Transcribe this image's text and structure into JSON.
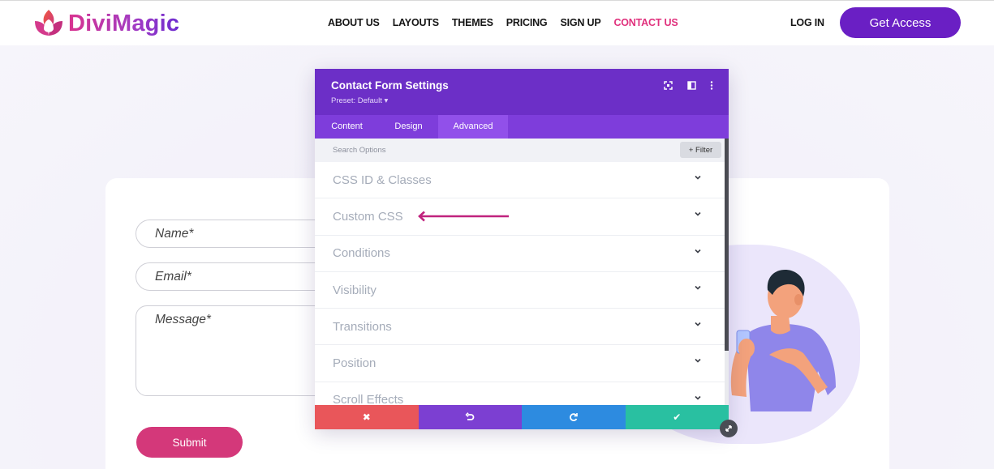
{
  "header": {
    "logo_text": "DiviMagic",
    "logo_icon": "lotus-logo-icon",
    "nav": [
      {
        "label": "ABOUT US"
      },
      {
        "label": "LAYOUTS"
      },
      {
        "label": "THEMES"
      },
      {
        "label": "PRICING"
      },
      {
        "label": "SIGN UP"
      },
      {
        "label": "CONTACT US",
        "active": true
      }
    ],
    "login_label": "LOG IN",
    "cta_label": "Get Access"
  },
  "form": {
    "name_placeholder": "Name*",
    "email_placeholder": "Email*",
    "message_placeholder": "Message*",
    "submit_label": "Submit"
  },
  "modal": {
    "title": "Contact Form Settings",
    "preset": "Preset: Default ▾",
    "header_icons": [
      "fullscreen-icon",
      "split-view-icon",
      "more-options-icon"
    ],
    "tabs": [
      {
        "label": "Content"
      },
      {
        "label": "Design"
      },
      {
        "label": "Advanced",
        "active": true
      }
    ],
    "search_placeholder": "Search Options",
    "filter_label": "+ Filter",
    "sections": [
      {
        "label": "CSS ID & Classes"
      },
      {
        "label": "Custom CSS"
      },
      {
        "label": "Conditions"
      },
      {
        "label": "Visibility"
      },
      {
        "label": "Transitions"
      },
      {
        "label": "Position"
      },
      {
        "label": "Scroll Effects"
      }
    ],
    "bottom_actions": [
      {
        "name": "discard-icon",
        "glyph": "✖",
        "color": "#e9565a"
      },
      {
        "name": "undo-icon",
        "color": "#7c3fd2"
      },
      {
        "name": "redo-icon",
        "color": "#2d8be0"
      },
      {
        "name": "save-check-icon",
        "glyph": "✔",
        "color": "#29c0a1"
      }
    ]
  },
  "colors": {
    "brand_purple": "#6a1fc4",
    "accent_pink": "#e0317d",
    "submit_pink": "#d4387a",
    "annotation_arrow": "#c0237e"
  }
}
